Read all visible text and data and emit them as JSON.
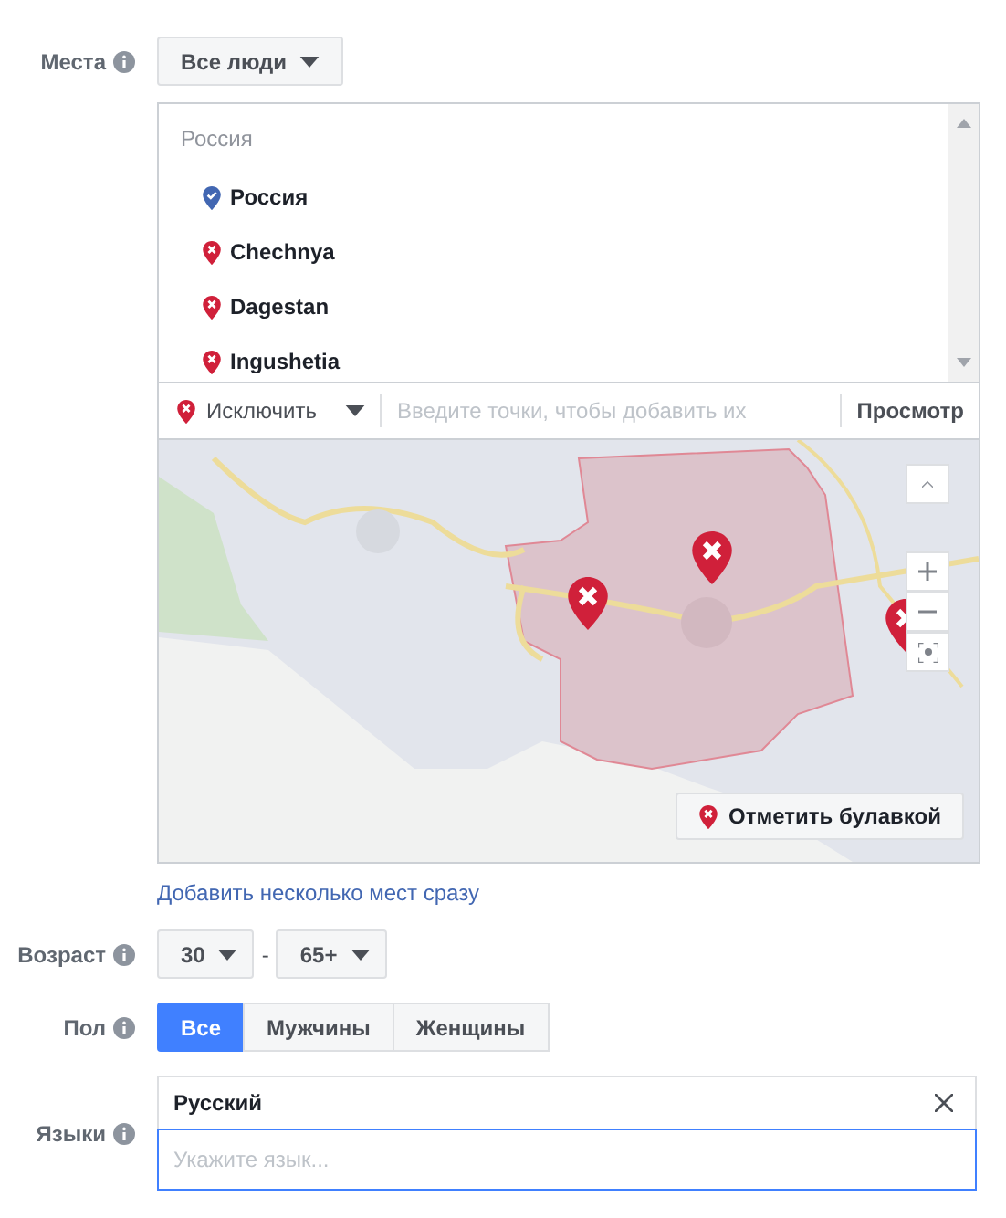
{
  "places": {
    "label": "Места",
    "audience": "Все люди",
    "group": "Россия",
    "items": [
      {
        "name": "Россия",
        "kind": "include"
      },
      {
        "name": "Chechnya",
        "kind": "exclude"
      },
      {
        "name": "Dagestan",
        "kind": "exclude"
      },
      {
        "name": "Ingushetia",
        "kind": "exclude"
      }
    ],
    "mode": "Исключить",
    "search_placeholder": "Введите точки, чтобы добавить их",
    "preview": "Просмотр",
    "drop_pin": "Отметить булавкой",
    "bulk_link": "Добавить несколько мест сразу"
  },
  "age": {
    "label": "Возраст",
    "min": "30",
    "separator": "-",
    "max": "65+"
  },
  "gender": {
    "label": "Пол",
    "options": [
      {
        "label": "Все",
        "selected": true
      },
      {
        "label": "Мужчины",
        "selected": false
      },
      {
        "label": "Женщины",
        "selected": false
      }
    ]
  },
  "languages": {
    "label": "Языки",
    "chips": [
      "Русский"
    ],
    "placeholder": "Укажите язык..."
  }
}
